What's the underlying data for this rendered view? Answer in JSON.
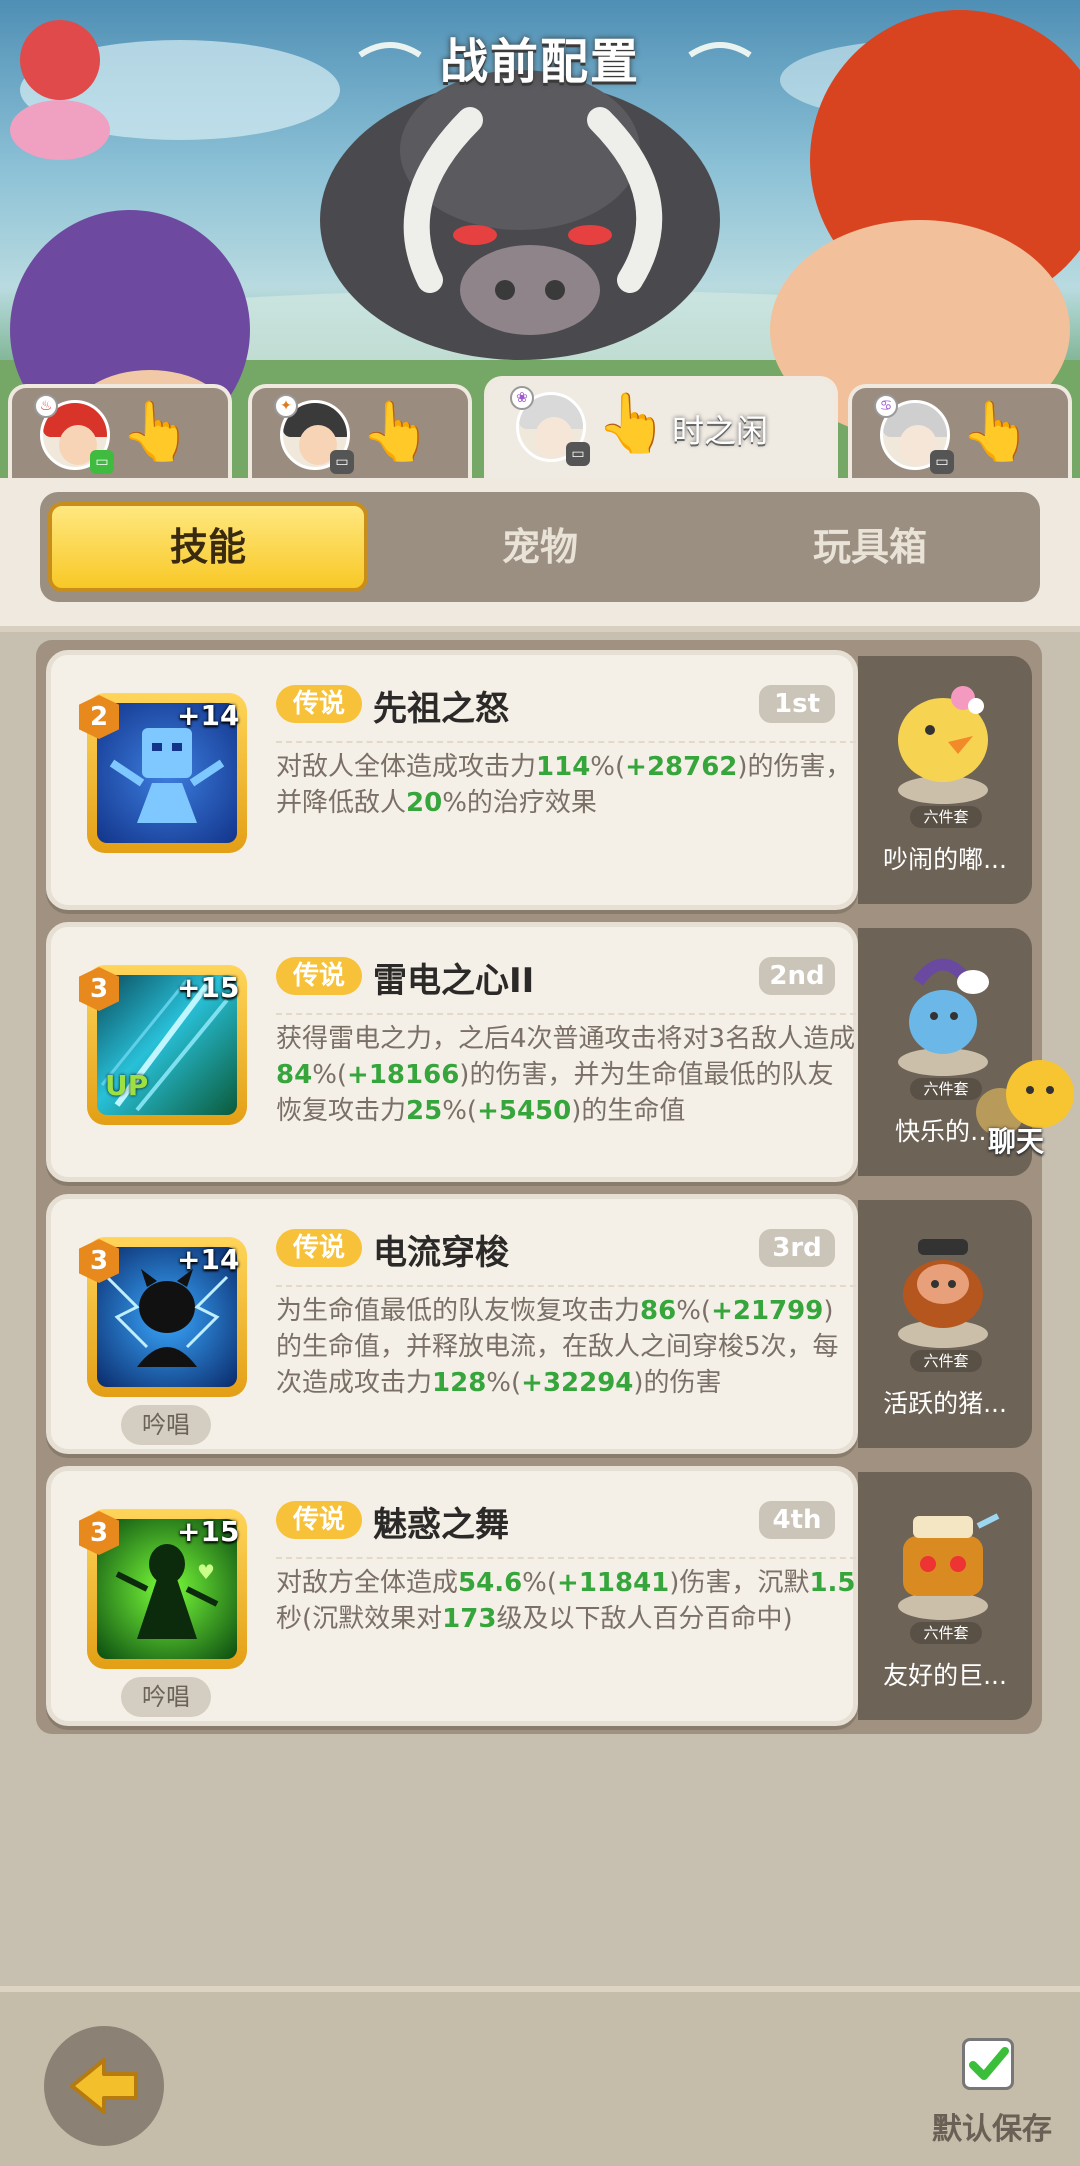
{
  "header": {
    "title": "战前配置"
  },
  "hero_tabs": [
    {
      "name": "",
      "element": "♨"
    },
    {
      "name": "",
      "element": "✦"
    },
    {
      "name": "时之闲",
      "element": "❀"
    },
    {
      "name": "",
      "element": "♋"
    }
  ],
  "segment_tabs": {
    "skills": "技能",
    "pets": "宠物",
    "toybox": "玩具箱"
  },
  "skills": [
    {
      "level": "2",
      "plus": "+14",
      "rarity": "传说",
      "name": "先祖之怒",
      "order": "1st",
      "desc": [
        {
          "t": "对敌人全体造成攻击力"
        },
        {
          "t": "114",
          "g": true
        },
        {
          "t": "%("
        },
        {
          "t": "+28762",
          "g": true
        },
        {
          "t": ")的伤害，并降低敌人"
        },
        {
          "t": "20",
          "g": true
        },
        {
          "t": "%的治疗效果"
        }
      ],
      "chant": "",
      "pet": {
        "name": "吵闹的嘟...",
        "set": "六件套"
      }
    },
    {
      "level": "3",
      "plus": "+15",
      "rarity": "传说",
      "name": "雷电之心II",
      "order": "2nd",
      "up": "UP",
      "desc": [
        {
          "t": "获得雷电之力，之后4次普通攻击将对3名敌人造成"
        },
        {
          "t": "84",
          "g": true
        },
        {
          "t": "%("
        },
        {
          "t": "+18166",
          "g": true
        },
        {
          "t": ")的伤害，并为生命值最低的队友恢复攻击力"
        },
        {
          "t": "25",
          "g": true
        },
        {
          "t": "%("
        },
        {
          "t": "+5450",
          "g": true
        },
        {
          "t": ")的生命值"
        }
      ],
      "chant": "",
      "pet": {
        "name": "快乐的…",
        "set": "六件套"
      }
    },
    {
      "level": "3",
      "plus": "+14",
      "rarity": "传说",
      "name": "电流穿梭",
      "order": "3rd",
      "desc": [
        {
          "t": "为生命值最低的队友恢复攻击力"
        },
        {
          "t": "86",
          "g": true
        },
        {
          "t": "%("
        },
        {
          "t": "+21799",
          "g": true
        },
        {
          "t": ")的生命值，并释放电流，在敌人之间穿梭5次，每次造成攻击力"
        },
        {
          "t": "128",
          "g": true
        },
        {
          "t": "%("
        },
        {
          "t": "+32294",
          "g": true
        },
        {
          "t": ")的伤害"
        }
      ],
      "chant": "吟唱",
      "pet": {
        "name": "活跃的猪...",
        "set": "六件套"
      }
    },
    {
      "level": "3",
      "plus": "+15",
      "rarity": "传说",
      "name": "魅惑之舞",
      "order": "4th",
      "desc": [
        {
          "t": "对敌方全体造成"
        },
        {
          "t": "54.6",
          "g": true
        },
        {
          "t": "%("
        },
        {
          "t": "+11841",
          "g": true
        },
        {
          "t": ")伤害，沉默"
        },
        {
          "t": "1.5",
          "g": true
        },
        {
          "t": "秒(沉默效果对"
        },
        {
          "t": "173",
          "g": true
        },
        {
          "t": "级及以下敌人百分百命中)"
        }
      ],
      "chant": "吟唱",
      "pet": {
        "name": "友好的巨...",
        "set": "六件套"
      }
    }
  ],
  "chat": {
    "label": "聊天"
  },
  "bottom": {
    "save_label": "默认保存"
  },
  "colors": {
    "accent_yellow": "#f8c826",
    "value_green": "#35a53c",
    "badge_orange": "#e8891e"
  }
}
